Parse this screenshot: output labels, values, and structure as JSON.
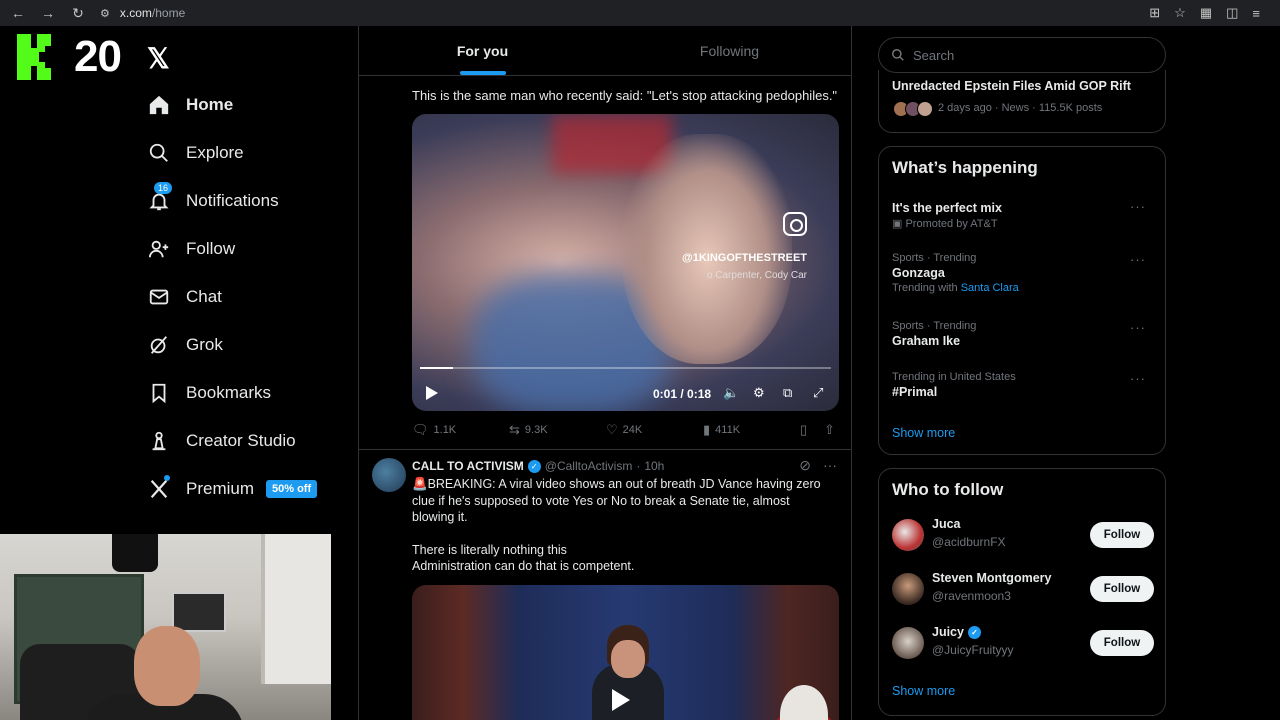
{
  "browser": {
    "url_host": "x.com",
    "url_path": "/home"
  },
  "overlay": {
    "kick_number": "20"
  },
  "sidebar": {
    "items": [
      {
        "label": "Home",
        "icon": "home-icon"
      },
      {
        "label": "Explore",
        "icon": "search-icon"
      },
      {
        "label": "Notifications",
        "icon": "bell-icon",
        "badge": "16"
      },
      {
        "label": "Follow",
        "icon": "person-add-icon"
      },
      {
        "label": "Chat",
        "icon": "mail-icon"
      },
      {
        "label": "Grok",
        "icon": "grok-icon"
      },
      {
        "label": "Bookmarks",
        "icon": "bookmark-icon"
      },
      {
        "label": "Creator Studio",
        "icon": "creator-icon"
      },
      {
        "label": "Premium",
        "icon": "x-icon",
        "badge": "50% off"
      }
    ]
  },
  "feed": {
    "tabs": [
      {
        "label": "For you",
        "active": true
      },
      {
        "label": "Following",
        "active": false
      }
    ],
    "post1": {
      "text": "This is the same man who recently said: \"Let's stop attacking pedophiles.\"",
      "video": {
        "overlay_handle": "@1KINGOFTHESTREET",
        "overlay_sub": "o Carpenter, Cody Car",
        "time": "0:01 / 0:18",
        "progress": 0.08
      },
      "stats": {
        "replies": "1.1K",
        "reposts": "9.3K",
        "likes": "24K",
        "views": "411K"
      }
    },
    "post2": {
      "name": "CALL TO ACTIVISM",
      "handle": "@CalltoActivism",
      "time": "10h",
      "text1": "🚨BREAKING: A viral video shows an out of breath JD Vance having zero clue if he's supposed to vote Yes or No to break a Senate tie, almost blowing it.",
      "text2a": "There is literally nothing this",
      "text2b": "Administration can do that is competent."
    }
  },
  "right": {
    "search_placeholder": "Search",
    "top_trend": {
      "title": "Unredacted Epstein Files Amid GOP Rift",
      "meta": "2 days ago · News · 115.5K posts"
    },
    "happening": {
      "title": "What’s happening",
      "trends": [
        {
          "context": "",
          "name": "It's the perfect mix",
          "sub": "Promoted by AT&T"
        },
        {
          "context": "Sports · Trending",
          "name": "Gonzaga",
          "sub_prefix": "Trending with",
          "sub_link": "Santa Clara"
        },
        {
          "context": "Sports · Trending",
          "name": "Graham Ike"
        },
        {
          "context": "Trending in United States",
          "name": "#Primal"
        }
      ],
      "show_more": "Show more"
    },
    "who_to_follow": {
      "title": "Who to follow",
      "users": [
        {
          "name": "Juca",
          "handle": "@acidburnFX",
          "button": "Follow"
        },
        {
          "name": "Steven Montgomery",
          "handle": "@ravenmoon3",
          "button": "Follow"
        },
        {
          "name": "Juicy",
          "handle": "@JuicyFruityyy",
          "button": "Follow"
        }
      ],
      "show_more": "Show more"
    }
  }
}
